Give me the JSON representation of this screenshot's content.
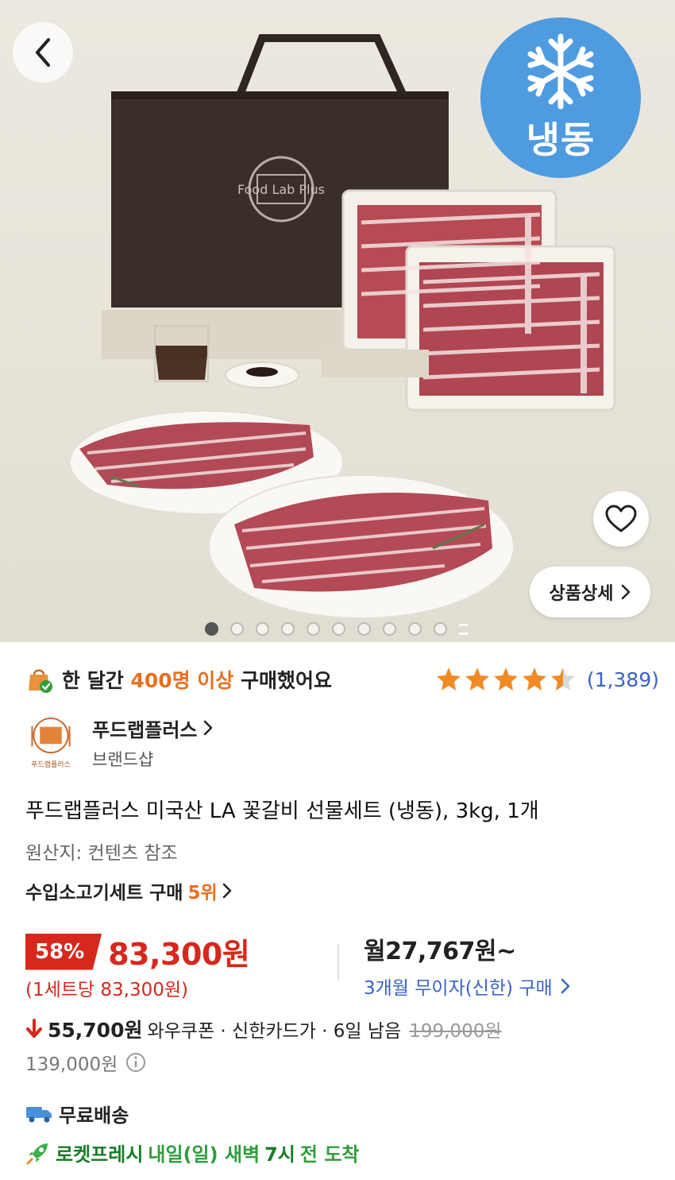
{
  "hero": {
    "frozen_label": "냉동",
    "detail_button_label": "상품상세",
    "carousel": {
      "total_dots": 10,
      "active_index": 0
    },
    "bag_logo_text": "Food Lab Plus"
  },
  "purchase": {
    "prefix": "한 달간 ",
    "highlight": "400명 이상",
    "suffix": " 구매했어요"
  },
  "rating": {
    "stars": 4.5,
    "count": "(1,389)"
  },
  "brand": {
    "name": "푸드랩플러스",
    "subtitle": "브랜드샵",
    "logo_caption": "푸드랩플러스"
  },
  "product": {
    "title": "푸드랩플러스 미국산 LA 꽃갈비 선물세트 (냉동), 3kg, 1개",
    "origin": "원산지: 컨텐츠 참조",
    "rank_prefix": "수입소고기세트 구매",
    "rank_value": "5위"
  },
  "price": {
    "discount": "58%",
    "sale": "83,300원",
    "unit": "(1세트당 83,300원)",
    "monthly": "월27,767원~",
    "installment": "3개월 무이자(신한) 구매",
    "coupon_amount": "55,700원",
    "coupon_desc": "와우쿠폰 · 신한카드가 · 6일 남음",
    "original": "199,000원",
    "final": "139,000원"
  },
  "shipping": {
    "free_label": "무료배송",
    "rocket_brand": "로켓프레시",
    "delivery_text_1": "내일(일) 새벽",
    "delivery_time": "7시",
    "delivery_text_2": "전 도착"
  },
  "colors": {
    "accent_red": "#d6281c",
    "accent_orange": "#e8701f",
    "link_blue": "#3b62c4",
    "rocket_green": "#2e9e3a",
    "frozen_blue": "#4f9be0"
  }
}
